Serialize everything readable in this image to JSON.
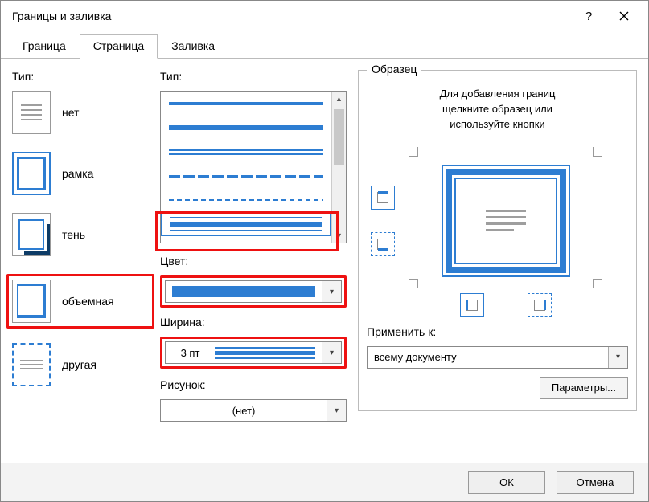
{
  "dialog": {
    "title": "Границы и заливка",
    "help_tooltip": "Справка",
    "close_tooltip": "Закрыть"
  },
  "tabs": {
    "border": {
      "label": "Граница",
      "hotkey_index": 0
    },
    "page": {
      "label": "Страница",
      "hotkey_index": 0
    },
    "shading": {
      "label": "Заливка",
      "hotkey_index": 0
    }
  },
  "left": {
    "label": "Тип:",
    "presets": {
      "none": "нет",
      "box": "рамка",
      "shadow": "тень",
      "threeD": "объемная",
      "custom": "другая"
    }
  },
  "middle": {
    "style_label": "Тип:",
    "color_label": "Цвет:",
    "width_label": "Ширина:",
    "width_value": "3 пт",
    "art_label": "Рисунок:",
    "art_value": "(нет)"
  },
  "right": {
    "group_label": "Образец",
    "hint_line1": "Для добавления границ",
    "hint_line2": "щелкните образец или",
    "hint_line3": "используйте кнопки",
    "applyto_label": "Применить к:",
    "applyto_value": "всему документу",
    "params_button": "Параметры..."
  },
  "footer": {
    "ok": "ОК",
    "cancel": "Отмена"
  },
  "colors": {
    "accent": "#2d7dd2"
  }
}
